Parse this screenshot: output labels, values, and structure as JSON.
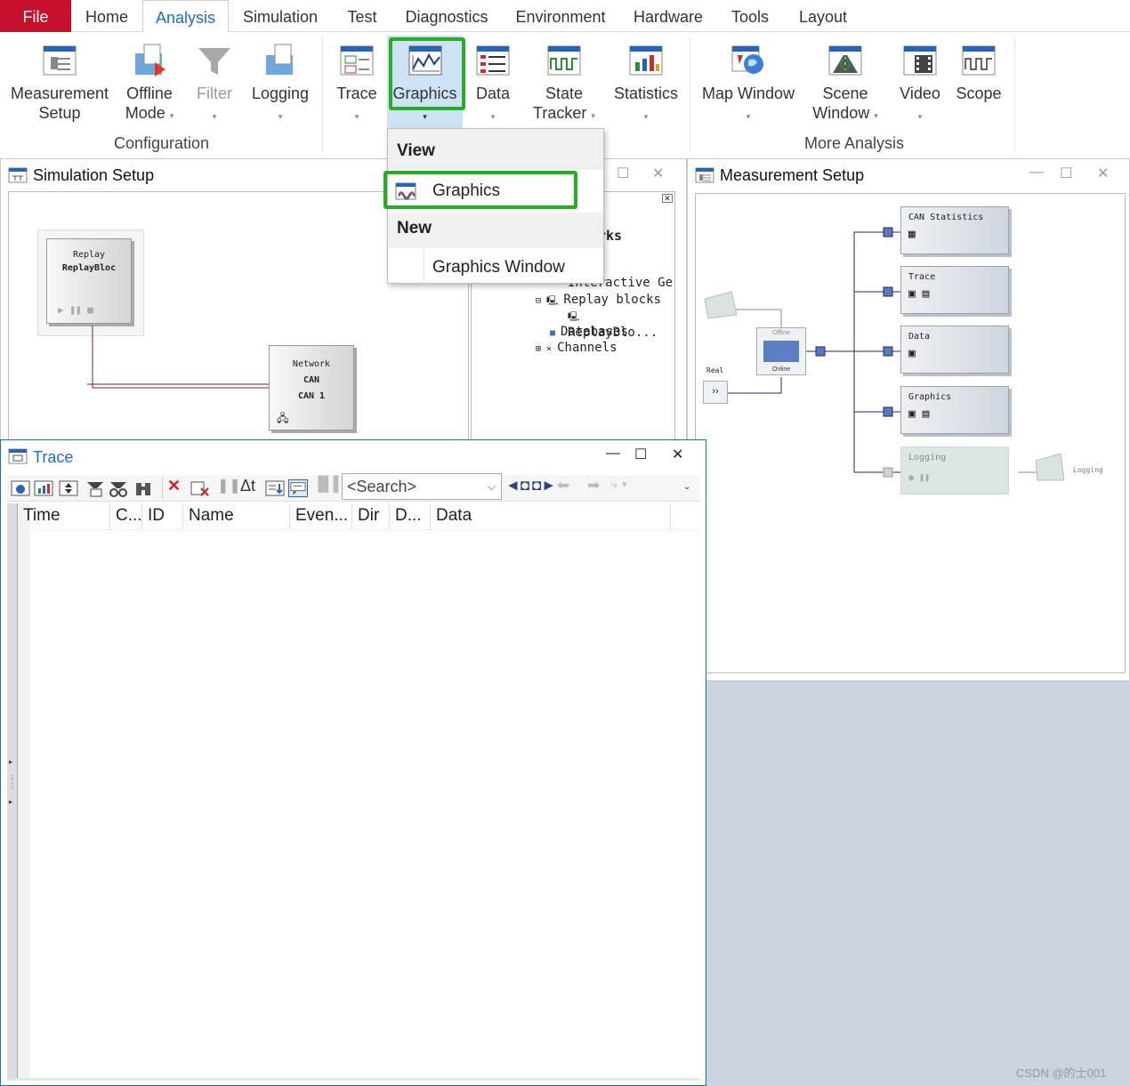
{
  "tabs": [
    {
      "label": "File"
    },
    {
      "label": "Home"
    },
    {
      "label": "Analysis"
    },
    {
      "label": "Simulation"
    },
    {
      "label": "Test"
    },
    {
      "label": "Diagnostics"
    },
    {
      "label": "Environment"
    },
    {
      "label": "Hardware"
    },
    {
      "label": "Tools"
    },
    {
      "label": "Layout"
    }
  ],
  "ribbon": {
    "buttons": [
      {
        "line1": "Measurement",
        "line2": "Setup",
        "icon": "measurement-setup-icon"
      },
      {
        "line1": "Offline",
        "line2": "Mode",
        "icon": "offline-mode-icon"
      },
      {
        "line1": "Filter",
        "icon": "filter-icon"
      },
      {
        "line1": "Logging",
        "icon": "logging-icon"
      },
      {
        "line1": "Trace",
        "icon": "trace-icon"
      },
      {
        "line1": "Graphics",
        "icon": "graphics-icon"
      },
      {
        "line1": "Data",
        "icon": "data-icon"
      },
      {
        "line1": "State",
        "line2": "Tracker",
        "icon": "state-tracker-icon"
      },
      {
        "line1": "Statistics",
        "icon": "statistics-icon"
      },
      {
        "line1": "Map Window",
        "icon": "map-window-icon"
      },
      {
        "line1": "Scene",
        "line2": "Window",
        "icon": "scene-window-icon"
      },
      {
        "line1": "Video",
        "icon": "video-icon"
      },
      {
        "line1": "Scope",
        "icon": "scope-icon"
      }
    ],
    "groups": {
      "configuration": "Configuration",
      "more_analysis": "More Analysis"
    }
  },
  "dropdown": {
    "view_header": "View",
    "view_item": "Graphics",
    "new_header": "New",
    "new_item": "Graphics Window"
  },
  "simulation_setup": {
    "title": "Simulation Setup",
    "replay_block": {
      "line1": "Replay",
      "line2": "ReplayBloc"
    },
    "network_block": {
      "line1": "Network",
      "line2": "CAN",
      "line3": "CAN 1"
    },
    "tree": {
      "partial_header": "rks",
      "items": [
        "Interactive Ge",
        "Replay blocks",
        "ReplayBlo...",
        "Databases",
        "Channels"
      ]
    }
  },
  "measurement_setup": {
    "title": "Measurement Setup",
    "blocks": [
      "CAN Statistics",
      "Trace",
      "Data",
      "Graphics",
      "Logging"
    ],
    "offline_label": "Offline",
    "online_label": "Online",
    "real_label": "Real",
    "logging_label": "Logging"
  },
  "trace": {
    "title": "Trace",
    "search_placeholder": "<Search>",
    "columns": [
      "Time",
      "C...",
      "ID",
      "Name",
      "Even...",
      "Dir",
      "D...",
      "Data"
    ]
  },
  "watermark": "CSDN @的士001",
  "colors": {
    "file_tab": "#c8102e",
    "active_tab_text": "#1c6dc7",
    "highlight": "#22b022",
    "ribbon_active": "#cde3f5",
    "background_panel": "#cbd3e1"
  }
}
